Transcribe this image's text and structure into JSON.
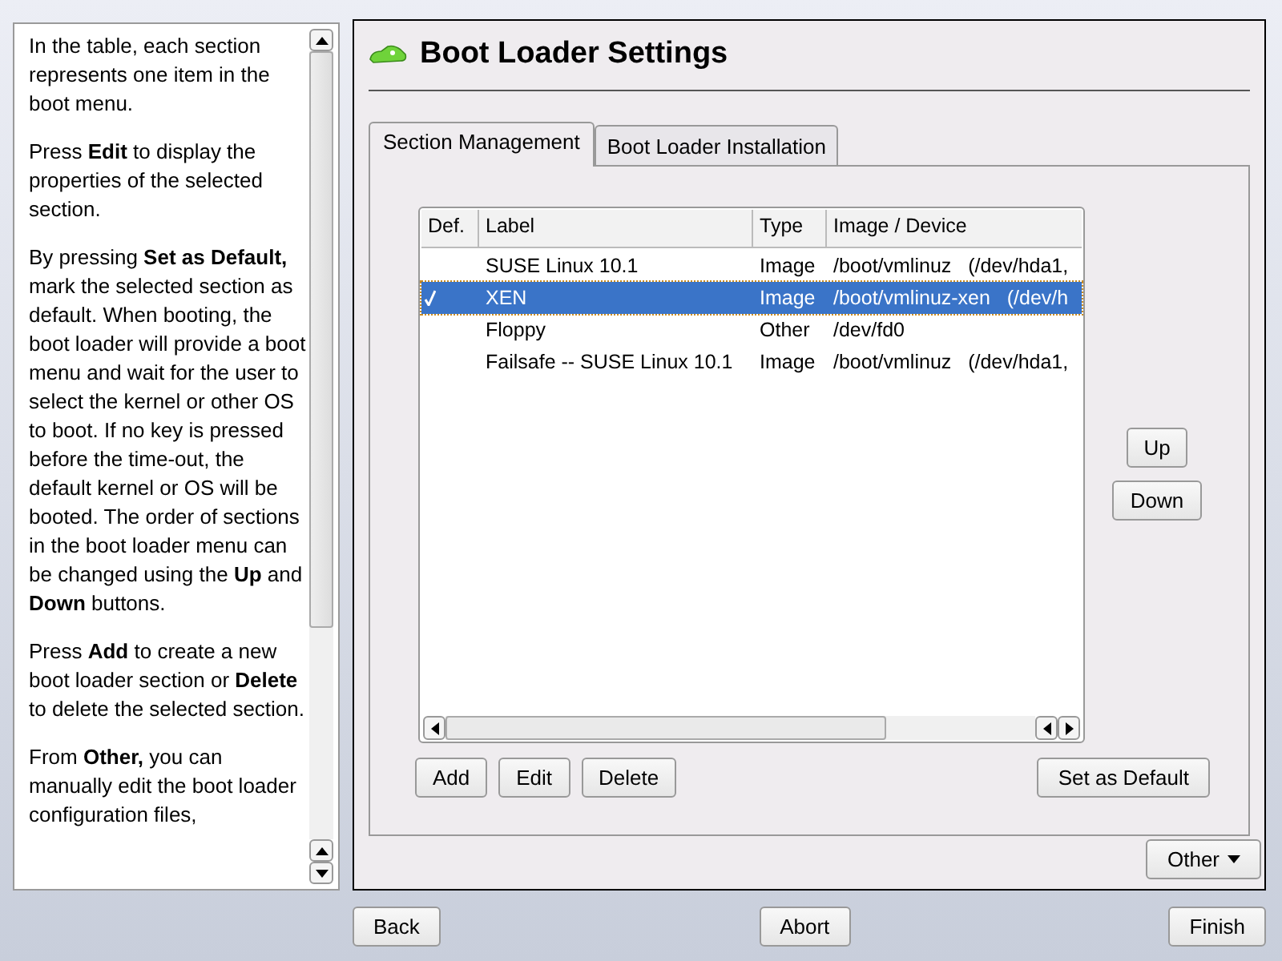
{
  "help": {
    "paragraphs": [
      "In the table, each section represents one item in the boot menu.",
      "Press **Edit** to display the properties of the selected section.",
      "By pressing **Set as Default,** mark the selected section as default. When booting, the boot loader will provide a boot menu and wait for the user to select the kernel or other OS to boot. If no key is pressed before the time-out, the default kernel or OS will be booted. The order of sections in the boot loader menu can be changed using the **Up** and **Down** buttons.",
      "Press **Add** to create a new boot loader section or **Delete** to delete the selected section.",
      "From **Other,** you can manually edit the boot loader configuration files,"
    ]
  },
  "title": "Boot Loader Settings",
  "tabs": [
    {
      "label": "Section Management",
      "selected": true
    },
    {
      "label": "Boot Loader Installation",
      "selected": false
    }
  ],
  "table": {
    "columns": [
      "Def.",
      "Label",
      "Type",
      "Image / Device"
    ],
    "rows": [
      {
        "default": false,
        "selected": false,
        "label": "SUSE Linux 10.1",
        "type": "Image",
        "image": "/boot/vmlinuz   (/dev/hda1,"
      },
      {
        "default": true,
        "selected": true,
        "label": "XEN",
        "type": "Image",
        "image": "/boot/vmlinuz-xen   (/dev/h"
      },
      {
        "default": false,
        "selected": false,
        "label": "Floppy",
        "type": "Other",
        "image": "/dev/fd0"
      },
      {
        "default": false,
        "selected": false,
        "label": "Failsafe -- SUSE Linux 10.1",
        "type": "Image",
        "image": "/boot/vmlinuz   (/dev/hda1,"
      }
    ]
  },
  "move_buttons": [
    "Up",
    "Down"
  ],
  "table_buttons": [
    "Add",
    "Edit",
    "Delete"
  ],
  "default_button": "Set as Default",
  "other_button": "Other",
  "nav_buttons": {
    "back": "Back",
    "abort": "Abort",
    "finish": "Finish"
  }
}
